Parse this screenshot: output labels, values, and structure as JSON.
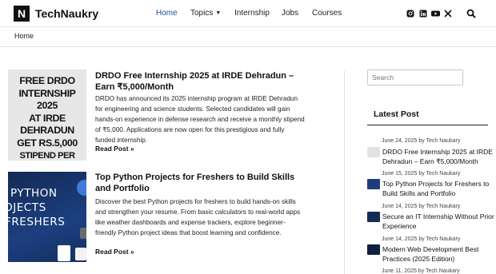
{
  "header": {
    "logo_letter": "N",
    "site_name": "TechNaukry",
    "nav": [
      "Home",
      "Topics",
      "Internship",
      "Jobs",
      "Courses"
    ],
    "active_nav": "Home",
    "accent_color": "#1d4fa5",
    "social_icons": [
      "instagram-icon",
      "linkedin-icon",
      "youtube-icon",
      "x-icon"
    ]
  },
  "breadcrumb": "Home",
  "posts": [
    {
      "thumb_text": [
        "FREE DRDO",
        "INTERNSHIP 2025",
        "AT IRDE",
        "DEHRADUN",
        "GET RS.5,000",
        "STIPEND PER MONTH"
      ],
      "title": "DRDO Free Internship 2025 at IRDE Dehradun – Earn ₹5,000/Month",
      "excerpt": "DRDO has announced its 2025 internship program at IRDE Dehradun for engineering and science students. Selected candidates will gain hands-on experience in defense research and receive a monthly stipend of ₹5,000. Applications are now open for this prestigious and fully funded internship.",
      "read_more": "Read Post »"
    },
    {
      "thumb_text": [
        "PYTHON",
        "OJECTS",
        "FRESHERS"
      ],
      "title": "Top Python Projects for Freshers to Build Skills and Portfolio",
      "excerpt": "Discover the best Python projects for freshers to build hands-on skills and strengthen your resume. From basic calculators to real-world apps like weather dashboards and expense trackers, explore beginner-friendly Python project ideas that boost learning and confidence.",
      "read_more": "Read Post »"
    }
  ],
  "sidebar": {
    "search_placeholder": "Search",
    "latest_title": "Latest Post",
    "latest_posts": [
      {
        "meta": "June 24, 2025 by Tech Naukary",
        "title": "DRDO Free Internship 2025 at IRDE Dehradun – Earn ₹5,000/Month"
      },
      {
        "meta": "June 15, 2025 by Tech Naukary",
        "title": "Top Python Projects for Freshers to Build Skills and Portfolio"
      },
      {
        "meta": "June 14, 2025 by Tech Naukary",
        "title": "Secure an IT Internship Without Prior Experience"
      },
      {
        "meta": "June 14, 2025 by Tech Naukary",
        "title": "Modern Web Development Best Practices (2025 Edition)"
      },
      {
        "meta": "June 11, 2025 by Tech Naukary",
        "title": ""
      }
    ]
  }
}
